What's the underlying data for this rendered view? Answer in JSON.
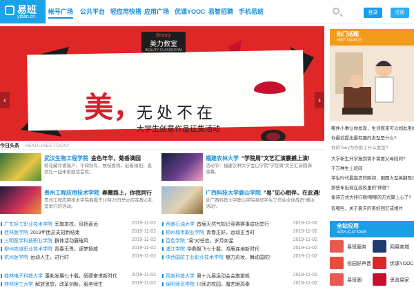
{
  "logo": {
    "name": "易班",
    "domain": "yiban.cn"
  },
  "nav": {
    "items": [
      "帐号广场",
      "公共平台",
      "轻应用快搭",
      "应用广场",
      "优课YOOC",
      "易智招聘",
      "手机易班"
    ]
  },
  "auth": {
    "login": "登录",
    "register": "注册"
  },
  "banner": {
    "badge_en": "Beauty",
    "badge_cn": "美力教室",
    "badge_small": "BEAUTY CLASSROOM",
    "mei": "美，",
    "headline": "无处不在",
    "subheadline": "大学生创意作品征集活动",
    "prev": "‹",
    "next": "›"
  },
  "today": {
    "title": "今日头条",
    "title_en": "HEADLINES TODAY"
  },
  "featured": [
    {
      "school": "武汉生物工程学院",
      "title": "金色年华，菊香满园",
      "desc": "菊花藏冷香霜户，不知秋有，数枝香尚。赴着福阳，直到扎一起来家庭活会就。"
    },
    {
      "school": "福建农林大学",
      "title": "“学院周”文艺汇演震撼上演!",
      "desc": "活动节：福建农林大学金山学院“学院周”文艺汇演圆满落幕。"
    },
    {
      "school": "贵州工程应用技术学院",
      "title": "春霞路上，你我同行",
      "desc": "贵州工程应用技术学院春霞于10月26日举办应在教心礼堂举行的活动。"
    },
    {
      "school": "广西科技大学鹿山学院",
      "title": "“易”见心相伴，在此遇!",
      "desc": "近广西科技大学鹿山学院易班学生工作站全体成员“暖冰活动”。"
    }
  ],
  "list_left": [
    {
      "school": "广东轻工职业技术学院",
      "title": "军旗本校，风扬菱远",
      "date": "2019-11-02"
    },
    {
      "school": "桂林医学院",
      "title": "2019年团总支招新结束",
      "date": "2019-11-02"
    },
    {
      "school": "三明医学科技职业学院",
      "title": "群体活动展璀风",
      "date": "2019-11-02"
    },
    {
      "school": "柳州铁道职业技术学院",
      "title": "青春无畏，逐梦扬威",
      "date": "2019-11-02"
    },
    {
      "school": "杭州医学院",
      "title": "运动人生，进行时",
      "date": "2019-11-02"
    },
    {
      "school": "桂林电子科技大学",
      "title": "蓬勃发展七十载，砥砺奋进新时代",
      "date": "2019-11-02"
    },
    {
      "school": "桂林理工大学",
      "title": "解放思想，改革创新，服务师生",
      "date": "2019-11-02"
    }
  ],
  "list_right": [
    {
      "school": "西南石油大学",
      "title": "首届天然气知识竞赛赛事成功举行",
      "date": "2019-11-02"
    },
    {
      "school": "柳州城市职业学院",
      "title": "青春正好，运动正当时",
      "date": "2019-11-02"
    },
    {
      "school": "百色学院",
      "title": "“易”对任信，岁月如星",
      "date": "2019-11-02"
    },
    {
      "school": "浦江学院",
      "title": "华鼎飘飞七十载，鸿雁连地新时代",
      "date": "2019-11-02"
    },
    {
      "school": "陕西国防工业职业技术学院",
      "title": "魅力彩妆，舞动国防!",
      "date": "2019-11-02"
    },
    {
      "school": "西南科技大学",
      "title": "第十九届运动会会旗拔帆",
      "date": "2019-11-02"
    },
    {
      "school": "绵阳师范学院",
      "title": "川师进校园，魔艺眼高秦",
      "date": "2019-11-02"
    }
  ],
  "hot": {
    "title": "热门话题",
    "title_en": "HOT TOPICS",
    "items": [
      {
        "text": "哪件小事让你发现，生活原来可以如此美好"
      },
      {
        "text": "你最近提出最有趣的发型是什么?"
      },
      {
        "text": "你的Tony为你剪了什么发型?"
      },
      {
        "text": "大学新生开学报到需不需要父母陪同?"
      },
      {
        "text": "千万种生上班间"
      },
      {
        "text": "学生时代最崩溃的瞬间，围圆大型英翻现场"
      },
      {
        "text": "那些年出现在高校里的“神兽”!"
      },
      {
        "text": "偷诗方式大排行榜!哪哪的方式算上心了?"
      },
      {
        "text": "有哪些，关于夏天的美好回忆或相片"
      }
    ]
  },
  "apps": {
    "title": "全站应用",
    "title_en": "APPLICATIONS",
    "items": [
      {
        "label": "易班服务",
        "color": "#e85a4f"
      },
      {
        "label": "网易商城",
        "color": "#1e3a6e"
      },
      {
        "label": "校园好声音",
        "color": "#e84c3d"
      },
      {
        "label": "优课YOOC",
        "color": "#d8262d"
      },
      {
        "label": "易班圈",
        "color": "#e75a53"
      },
      {
        "label": "思政易家",
        "color": "#c8102e"
      }
    ]
  }
}
